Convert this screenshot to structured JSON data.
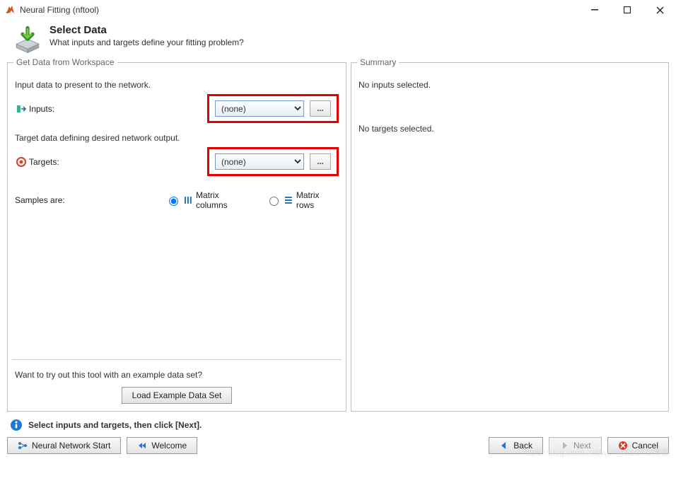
{
  "window": {
    "title": "Neural Fitting (nftool)"
  },
  "header": {
    "title": "Select Data",
    "subtitle": "What inputs and targets define your fitting problem?"
  },
  "leftPanel": {
    "legend": "Get Data from Workspace",
    "inputIntro": "Input data to present to the network.",
    "inputsLabel": "Inputs:",
    "inputsValue": "(none)",
    "targetIntro": "Target data defining desired network output.",
    "targetsLabel": "Targets:",
    "targetsValue": "(none)",
    "browse": "...",
    "samplesLabel": "Samples are:",
    "radioColumns": "Matrix columns",
    "radioRows": "Matrix rows",
    "exampleQuestion": "Want to try out this tool with an example data set?",
    "loadExample": "Load Example Data Set"
  },
  "rightPanel": {
    "legend": "Summary",
    "noInputs": "No inputs selected.",
    "noTargets": "No targets selected."
  },
  "hint": "Select inputs and targets, then click [Next].",
  "footer": {
    "nnStart": "Neural Network Start",
    "welcome": "Welcome",
    "back": "Back",
    "next": "Next",
    "cancel": "Cancel"
  },
  "watermark": "https://blog.csdn.net/wei  @51CTO博客"
}
